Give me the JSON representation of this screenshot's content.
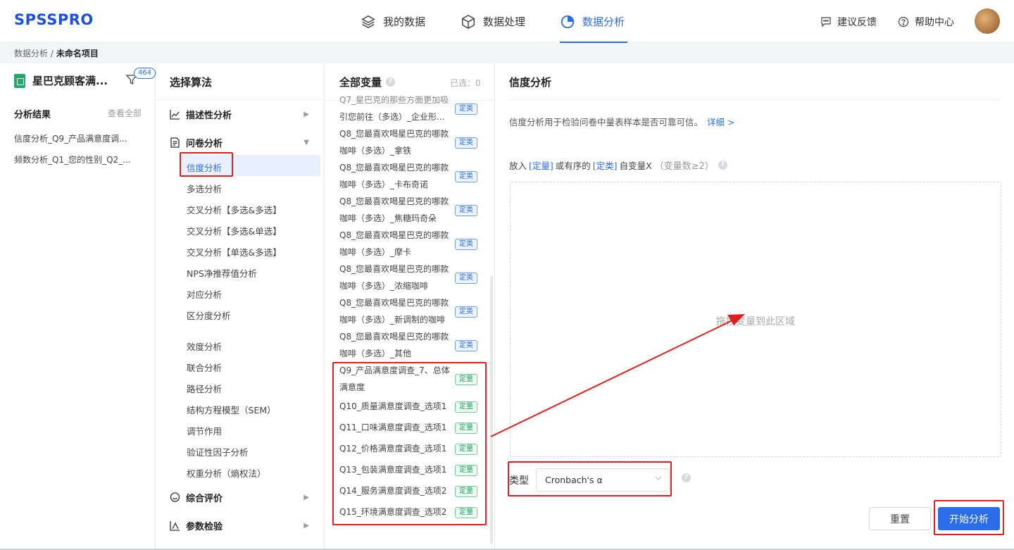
{
  "header": {
    "logo": "SPSSPRO",
    "nav": [
      {
        "label": "我的数据",
        "icon": "layers-icon"
      },
      {
        "label": "数据处理",
        "icon": "cube-icon"
      },
      {
        "label": "数据分析",
        "icon": "pie-chart-icon",
        "active": true
      }
    ],
    "feedback": "建议反馈",
    "help": "帮助中心",
    "accent_color": "#2b6de8"
  },
  "breadcrumb": {
    "root": "数据分析 /",
    "current": "未命名项目"
  },
  "left": {
    "project_name": "星巴克顾客满...",
    "filter_count": "464",
    "results_title": "分析结果",
    "view_all": "查看全部",
    "results": [
      "信度分析_Q9_产品满意度调...",
      "频数分析_Q1_您的性别_Q2_..."
    ]
  },
  "algorithms": {
    "title": "选择算法",
    "categories": {
      "descriptive": "描述性分析",
      "questionnaire": "问卷分析",
      "comprehensive": "综合评价",
      "parametric": "参数检验"
    },
    "items": [
      "信度分析",
      "多选分析",
      "交叉分析【多选&多选】",
      "交叉分析【多选&单选】",
      "交叉分析【单选&多选】",
      "NPS净推荐值分析",
      "对应分析",
      "区分度分析",
      "效度分析",
      "联合分析",
      "路径分析",
      "结构方程模型（SEM）",
      "调节作用",
      "验证性因子分析",
      "权重分析（熵权法）"
    ]
  },
  "variables": {
    "title": "全部变量",
    "selected": "已选：0",
    "items": [
      {
        "l1": "Q7_星巴克的那些方面更加吸",
        "l2": "引您前往（多选）_企业形...",
        "tag": "定类"
      },
      {
        "l1": "Q8_您最喜欢喝星巴克的哪款",
        "l2": "咖啡（多选）_拿铁",
        "tag": "定类"
      },
      {
        "l1": "Q8_您最喜欢喝星巴克的哪款",
        "l2": "咖啡（多选）_卡布奇诺",
        "tag": "定类"
      },
      {
        "l1": "Q8_您最喜欢喝星巴克的哪款",
        "l2": "咖啡（多选）_焦糖玛奇朵",
        "tag": "定类"
      },
      {
        "l1": "Q8_您最喜欢喝星巴克的哪款",
        "l2": "咖啡（多选）_摩卡",
        "tag": "定类"
      },
      {
        "l1": "Q8_您最喜欢喝星巴克的哪款",
        "l2": "咖啡（多选）_浓缩咖啡",
        "tag": "定类"
      },
      {
        "l1": "Q8_您最喜欢喝星巴克的哪款",
        "l2": "咖啡（多选）_新调制的咖啡",
        "tag": "定类"
      },
      {
        "l1": "Q8_您最喜欢喝星巴克的哪款",
        "l2": "咖啡（多选）_其他",
        "tag": "定类"
      },
      {
        "l1": "Q9_产品满意度调查_7、总体",
        "l2": "满意度",
        "tag": "定量"
      }
    ],
    "single": [
      {
        "l1": "Q10_质量满意度调查_选项1",
        "tag": "定量"
      },
      {
        "l1": "Q11_口味满意度调查_选项1",
        "tag": "定量"
      },
      {
        "l1": "Q12_价格满意度调查_选项1",
        "tag": "定量"
      },
      {
        "l1": "Q13_包装满意度调查_选项1",
        "tag": "定量"
      },
      {
        "l1": "Q14_服务满意度调查_选项2",
        "tag": "定量"
      },
      {
        "l1": "Q15_环境满意度调查_选项2",
        "tag": "定量"
      }
    ]
  },
  "config": {
    "title": "信度分析",
    "desc": "信度分析用于检验问卷中量表样本是否可靠可信。",
    "detail_link": "详细 >",
    "put_prefix": "放入",
    "put_quant": "[定量]",
    "put_mid": "或有序的",
    "put_class": "[定类]",
    "put_suffix": "自变量X",
    "put_hint": "（变量数≥2）",
    "dropzone_text": "拖拽变量到此区域",
    "type_label": "类型",
    "type_value": "Cronbach's α",
    "reset": "重置",
    "start": "开始分析"
  }
}
